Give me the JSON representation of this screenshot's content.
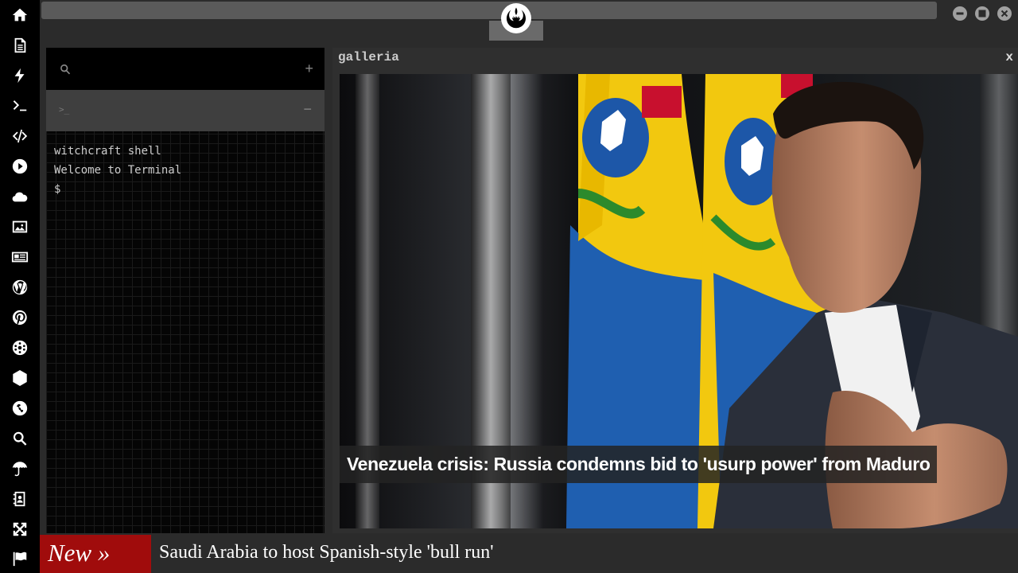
{
  "rail": {
    "items": [
      {
        "name": "home-icon"
      },
      {
        "name": "document-icon"
      },
      {
        "name": "lightning-icon"
      },
      {
        "name": "terminal-icon"
      },
      {
        "name": "code-icon"
      },
      {
        "name": "play-icon"
      },
      {
        "name": "cloud-icon"
      },
      {
        "name": "image-icon"
      },
      {
        "name": "newspaper-icon"
      },
      {
        "name": "wordpress-icon"
      },
      {
        "name": "pinterest-icon"
      },
      {
        "name": "snowflake-icon"
      },
      {
        "name": "hexagon-network-icon"
      },
      {
        "name": "globe-icon"
      },
      {
        "name": "search-icon"
      },
      {
        "name": "umbrella-icon"
      },
      {
        "name": "contacts-icon"
      },
      {
        "name": "expand-icon"
      },
      {
        "name": "flag-icon"
      }
    ]
  },
  "titlebar": {
    "logo": "rebel-alliance-icon",
    "window_controls": [
      "minimize-icon",
      "maximize-icon",
      "close-icon"
    ]
  },
  "terminal": {
    "search_icon": "search-icon",
    "add_label": "+",
    "tab_prompt": ">_",
    "tab_minimize_label": "−",
    "output": {
      "line1": "witchcraft shell",
      "line2": "Welcome to Terminal",
      "prompt": "$"
    }
  },
  "gallery": {
    "title": "galleria",
    "close_label": "x",
    "caption": "Venezuela crisis: Russia condemns bid to 'usurp power' from Maduro"
  },
  "ticker": {
    "badge": "New »",
    "headline": "Saudi Arabia to host Spanish-style 'bull run'"
  },
  "colors": {
    "background": "#2b2b2b",
    "rail": "#000000",
    "ticker_badge": "#a00c0c",
    "flag_yellow": "#f2c80f",
    "flag_blue": "#1f5fb0",
    "flag_red": "#c8102e"
  }
}
